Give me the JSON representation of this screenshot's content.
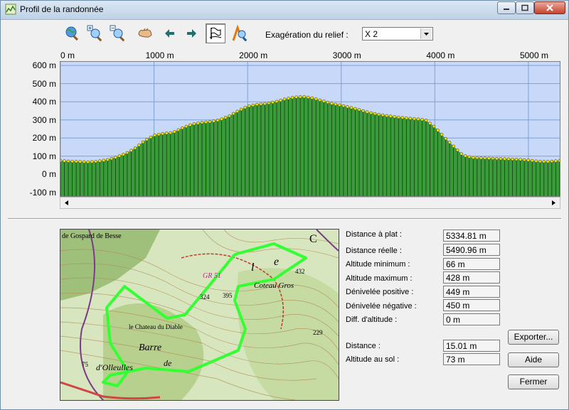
{
  "window": {
    "title": "Profil de la randonnée",
    "controls": [
      "minimize-icon",
      "maximize-icon",
      "close-icon"
    ]
  },
  "toolbar": {
    "buttons": [
      {
        "icon": "zoom-globe-icon"
      },
      {
        "icon": "zoom-in-icon"
      },
      {
        "icon": "zoom-out-icon"
      },
      {
        "icon": "pan-hand-icon"
      },
      {
        "icon": "arrow-left-icon"
      },
      {
        "icon": "arrow-right-icon"
      },
      {
        "icon": "flag-icon",
        "pressed": true
      },
      {
        "icon": "hiker-icon"
      }
    ],
    "exaggeration_label": "Exagération du relief :",
    "exaggeration_value": "X 2"
  },
  "chart_data": {
    "type": "area",
    "x_ticks": [
      "0 m",
      "1000 m",
      "2000 m",
      "3000 m",
      "4000 m",
      "5000 m"
    ],
    "y_ticks": [
      "600 m",
      "500 m",
      "400 m",
      "300 m",
      "200 m",
      "100 m",
      "0 m",
      "-100 m"
    ],
    "xlim": [
      0,
      5334.81
    ],
    "ylim": [
      -120,
      620
    ],
    "colors": {
      "fill": "#3b9b3b",
      "background": "#c8d8f8",
      "grid": "#7f9fd8",
      "points": "#f2e200"
    },
    "points": [
      [
        0,
        75
      ],
      [
        100,
        72
      ],
      [
        200,
        70
      ],
      [
        300,
        68
      ],
      [
        400,
        72
      ],
      [
        500,
        80
      ],
      [
        600,
        95
      ],
      [
        700,
        115
      ],
      [
        800,
        145
      ],
      [
        900,
        185
      ],
      [
        1000,
        215
      ],
      [
        1100,
        225
      ],
      [
        1200,
        230
      ],
      [
        1300,
        255
      ],
      [
        1400,
        275
      ],
      [
        1500,
        285
      ],
      [
        1600,
        290
      ],
      [
        1700,
        300
      ],
      [
        1800,
        320
      ],
      [
        1900,
        350
      ],
      [
        2000,
        375
      ],
      [
        2100,
        385
      ],
      [
        2200,
        390
      ],
      [
        2300,
        400
      ],
      [
        2400,
        415
      ],
      [
        2500,
        425
      ],
      [
        2600,
        428
      ],
      [
        2700,
        420
      ],
      [
        2800,
        405
      ],
      [
        2900,
        390
      ],
      [
        3000,
        380
      ],
      [
        3100,
        368
      ],
      [
        3200,
        355
      ],
      [
        3300,
        340
      ],
      [
        3400,
        330
      ],
      [
        3500,
        322
      ],
      [
        3600,
        315
      ],
      [
        3700,
        310
      ],
      [
        3800,
        305
      ],
      [
        3900,
        300
      ],
      [
        4000,
        260
      ],
      [
        4100,
        205
      ],
      [
        4200,
        155
      ],
      [
        4300,
        105
      ],
      [
        4400,
        92
      ],
      [
        4500,
        90
      ],
      [
        4600,
        88
      ],
      [
        4700,
        86
      ],
      [
        4800,
        84
      ],
      [
        4900,
        82
      ],
      [
        5000,
        78
      ],
      [
        5100,
        72
      ],
      [
        5200,
        70
      ],
      [
        5334.81,
        75
      ]
    ]
  },
  "map": {
    "labels": [
      {
        "text": "de Gospard de Besse",
        "icon": "text"
      },
      {
        "text": "GR 51"
      },
      {
        "text": "l"
      },
      {
        "text": "e"
      },
      {
        "text": "C"
      },
      {
        "text": "Coteau Gros"
      },
      {
        "text": "324"
      },
      {
        "text": "395"
      },
      {
        "text": "432"
      },
      {
        "text": "le Chateau du Diable"
      },
      {
        "text": "Barre"
      },
      {
        "text": "de"
      },
      {
        "text": "d'Olleulles"
      },
      {
        "text": "229"
      },
      {
        "text": "75"
      }
    ]
  },
  "stats": [
    {
      "label": "Distance à plat :",
      "value": "5334.81 m"
    },
    {
      "label": "Distance réelle :",
      "value": "5490.96 m"
    },
    {
      "label": "Altitude minimum :",
      "value": "66 m"
    },
    {
      "label": "Altitude maximum :",
      "value": "428 m"
    },
    {
      "label": "Dénivelée positive :",
      "value": "449 m"
    },
    {
      "label": "Dénivelée négative :",
      "value": "450 m"
    },
    {
      "label": "Diff. d'altitude :",
      "value": "0 m"
    }
  ],
  "cursor": [
    {
      "label": "Distance :",
      "value": "15.01 m"
    },
    {
      "label": "Altitude au sol :",
      "value": "73 m"
    }
  ],
  "buttons": {
    "export": "Exporter...",
    "help": "Aide",
    "close": "Fermer"
  }
}
